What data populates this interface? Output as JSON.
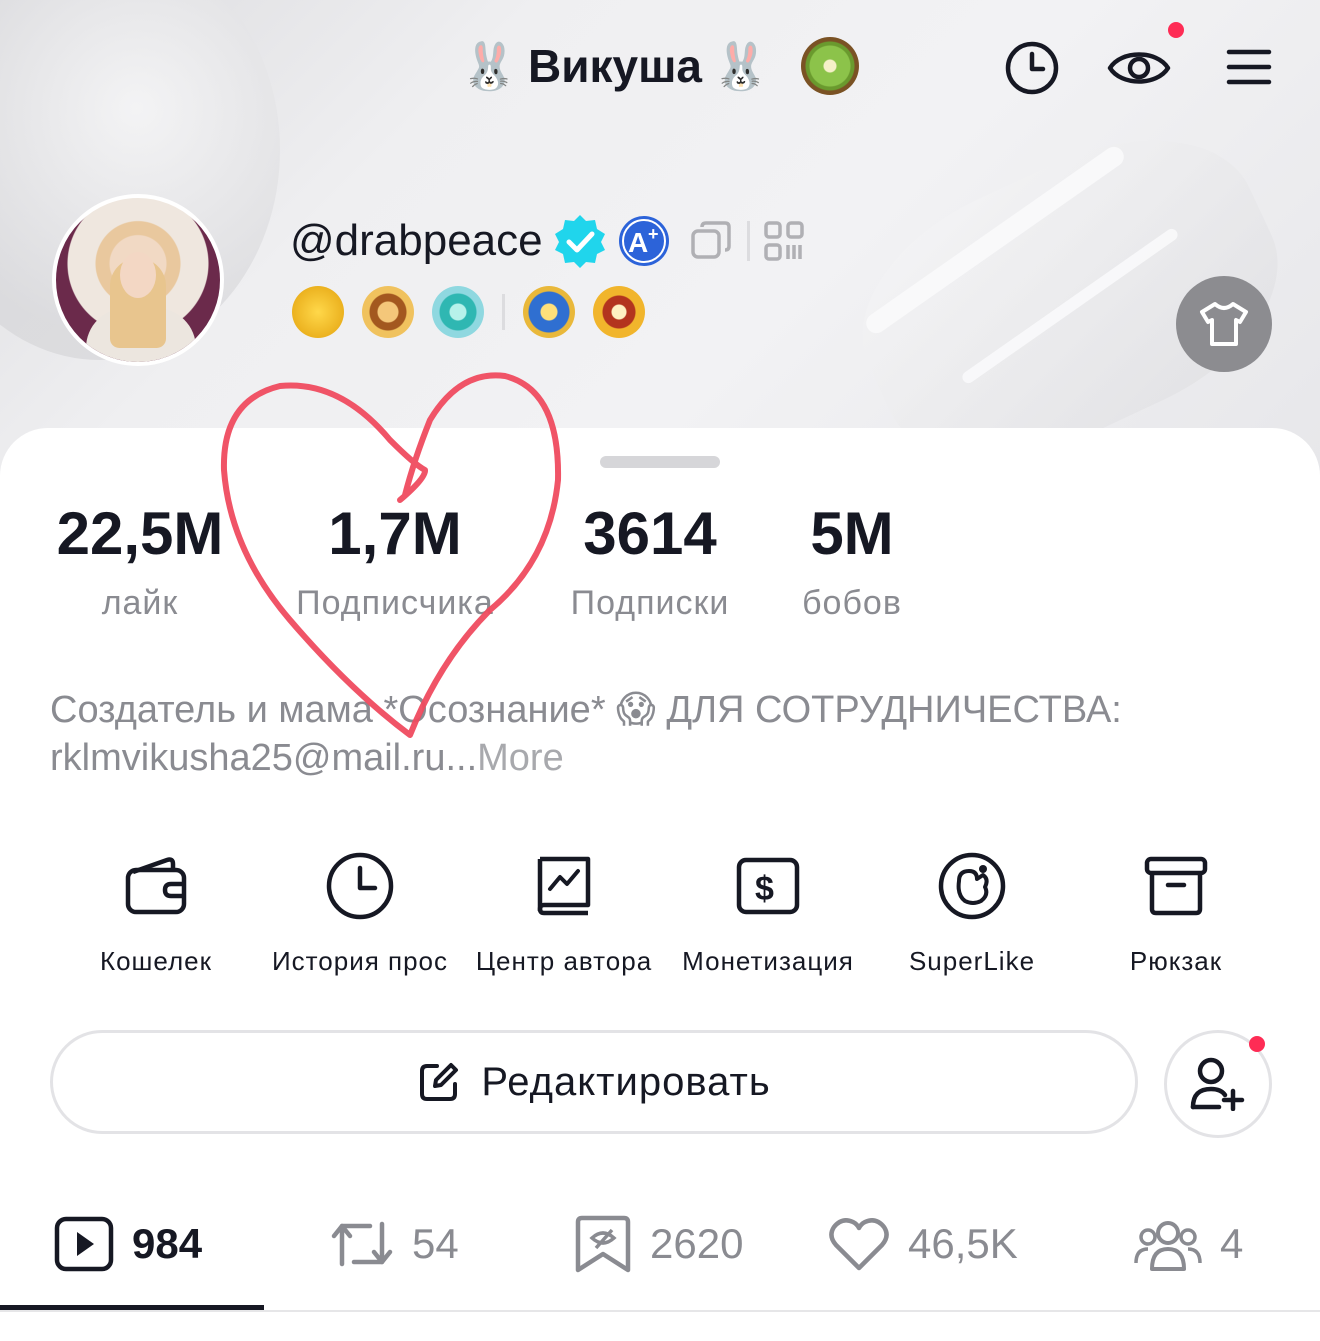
{
  "header": {
    "display_name": "Викуша",
    "name_emoji": "🐰",
    "name_suffix_emoji": "kiwi"
  },
  "profile": {
    "handle": "@drabpeace",
    "verified": true
  },
  "stats": [
    {
      "value": "22,5M",
      "label": "лайк"
    },
    {
      "value": "1,7M",
      "label": "Подписчика"
    },
    {
      "value": "3614",
      "label": "Подписки"
    },
    {
      "value": "5M",
      "label": "бобов"
    }
  ],
  "bio": {
    "text": "Создатель и мама *Осознание* 😱 ДЛЯ СОТРУДНИЧЕСТВА: rklmvikusha25@mail.ru...",
    "more": "More"
  },
  "tools": [
    {
      "label": "Кошелек",
      "icon": "wallet-icon"
    },
    {
      "label": "История прос",
      "icon": "clock-icon"
    },
    {
      "label": "Центр автора",
      "icon": "creator-center-icon"
    },
    {
      "label": "Монетизация",
      "icon": "dollar-icon"
    },
    {
      "label": "SuperLike",
      "icon": "superlike-icon"
    },
    {
      "label": "Рюкзак",
      "icon": "box-icon"
    }
  ],
  "actions": {
    "edit_label": "Редактировать"
  },
  "tabs": [
    {
      "count": "984",
      "icon": "video-icon",
      "active": true
    },
    {
      "count": "54",
      "icon": "repost-icon"
    },
    {
      "count": "2620",
      "icon": "favorites-icon"
    },
    {
      "count": "46,5K",
      "icon": "heart-icon"
    },
    {
      "count": "4",
      "icon": "group-icon"
    }
  ],
  "colors": {
    "notification": "#fe2c55",
    "verified": "#20d5ec",
    "heart_drawing": "#ef4b5f"
  }
}
